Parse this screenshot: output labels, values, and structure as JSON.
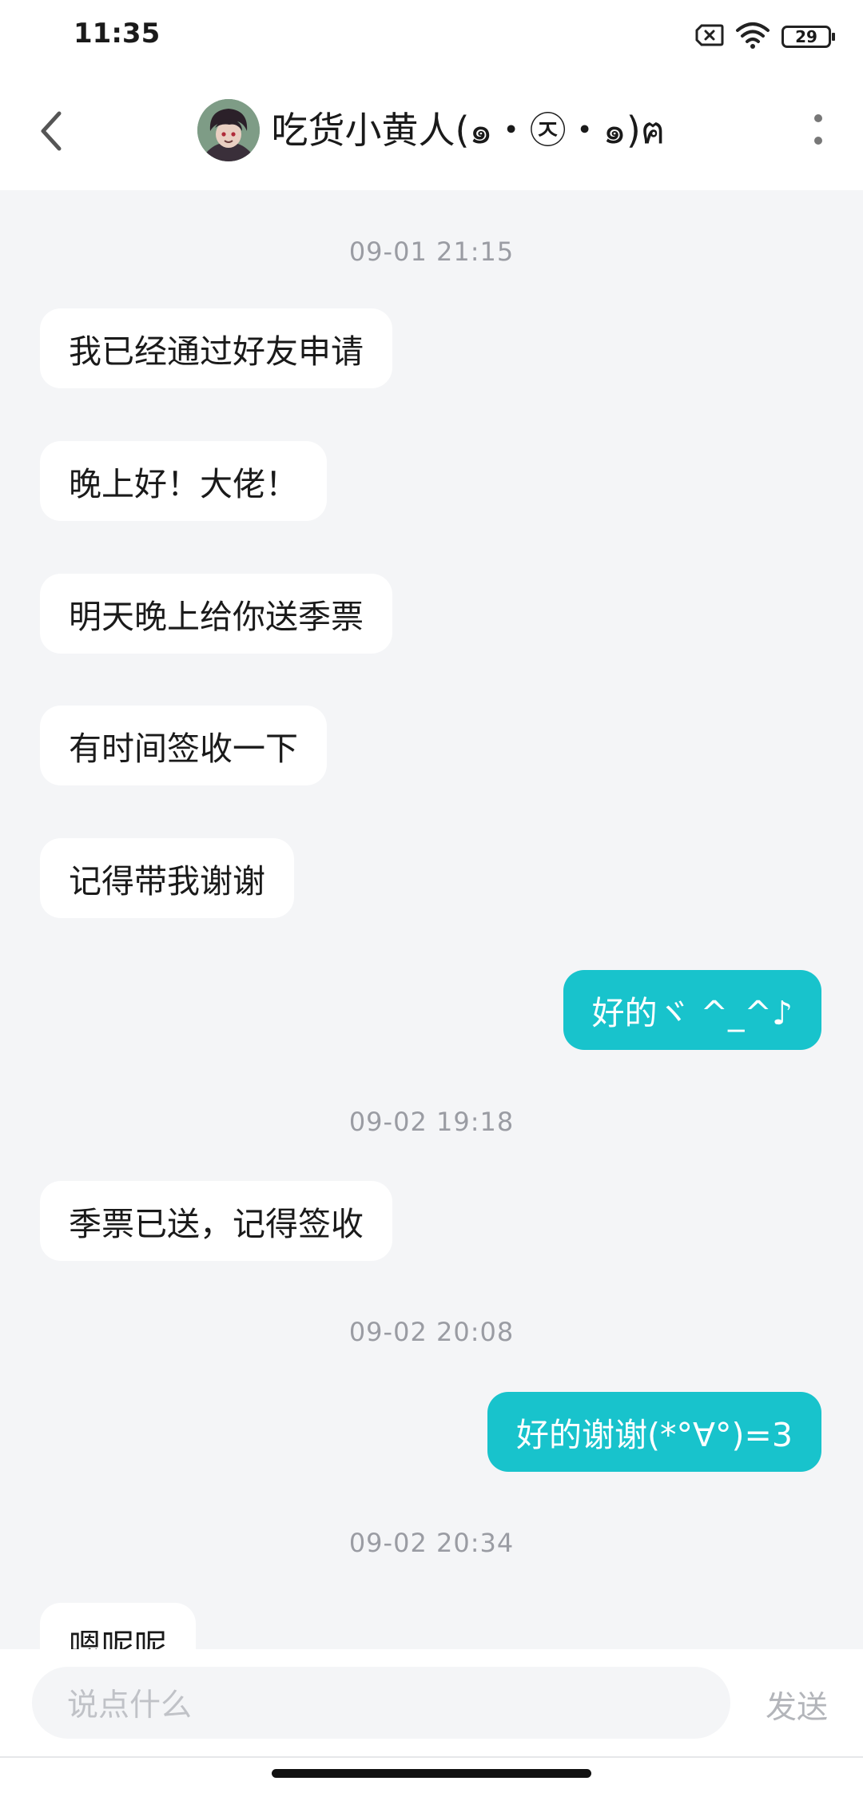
{
  "status_bar": {
    "time": "11:35",
    "battery": "29",
    "icons": [
      "sim-off-icon",
      "wifi-icon",
      "battery-icon"
    ]
  },
  "header": {
    "title": "吃货小黄人(๑・㉨・๑)ฅ",
    "back_icon": "chevron-left-icon",
    "more_icon": "more-vertical-icon"
  },
  "messages": [
    {
      "type": "timestamp",
      "text": "09-01 21:15"
    },
    {
      "type": "incoming",
      "text": "我已经通过好友申请"
    },
    {
      "type": "incoming",
      "text": "晚上好！大佬！"
    },
    {
      "type": "incoming",
      "text": "明天晚上给你送季票"
    },
    {
      "type": "incoming",
      "text": "有时间签收一下"
    },
    {
      "type": "incoming",
      "text": "记得带我谢谢"
    },
    {
      "type": "outgoing",
      "text": "好的ヾ ^_^♪"
    },
    {
      "type": "timestamp",
      "text": "09-02 19:18"
    },
    {
      "type": "incoming",
      "text": "季票已送，记得签收"
    },
    {
      "type": "timestamp",
      "text": "09-02 20:08"
    },
    {
      "type": "outgoing",
      "text": "好的谢谢(*°∀°)=3"
    },
    {
      "type": "timestamp",
      "text": "09-02 20:34"
    },
    {
      "type": "incoming",
      "text": "嗯呢呢"
    }
  ],
  "composer": {
    "placeholder": "说点什么",
    "send_label": "发送"
  },
  "colors": {
    "accent": "#18c3cc",
    "background": "#f4f5f7",
    "bubble_incoming": "#ffffff"
  }
}
